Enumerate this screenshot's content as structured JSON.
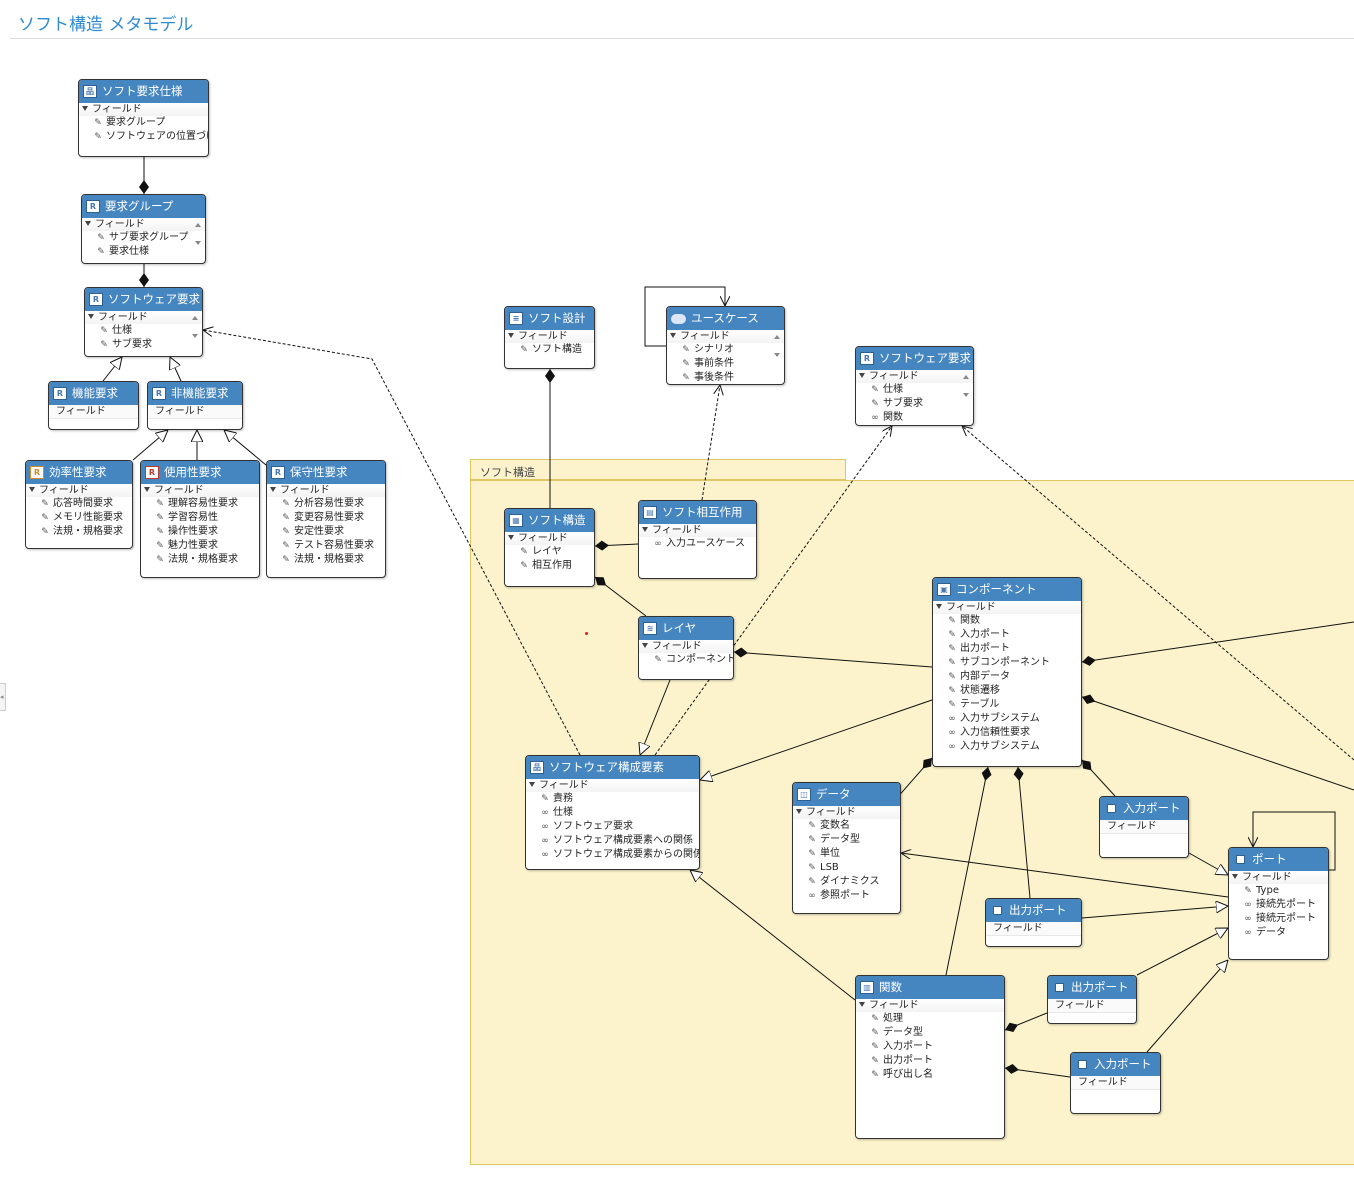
{
  "header": {
    "title": "ソフト構造 メタモデル"
  },
  "container": {
    "label": "ソフト構造"
  },
  "section_fields": "フィールド",
  "boxes": {
    "b_yokyushiyo": {
      "title": "ソフト要求仕様",
      "icon": "hierarchy-icon",
      "fields": [
        {
          "k": "wrench",
          "t": "要求グループ"
        },
        {
          "k": "wrench",
          "t": "ソフトウェアの位置づけ"
        }
      ]
    },
    "b_group": {
      "title": "要求グループ",
      "icon": "requirement-icon",
      "fields": [
        {
          "k": "wrench",
          "t": "サブ要求グループ"
        },
        {
          "k": "wrench",
          "t": "要求仕様"
        }
      ]
    },
    "b_swreq": {
      "title": "ソフトウェア要求",
      "icon": "requirement-icon",
      "fields": [
        {
          "k": "wrench",
          "t": "仕様"
        },
        {
          "k": "wrench",
          "t": "サブ要求"
        }
      ]
    },
    "b_kino": {
      "title": "機能要求",
      "icon": "requirement-icon",
      "fields": []
    },
    "b_hikino": {
      "title": "非機能要求",
      "icon": "requirement-icon",
      "fields": []
    },
    "b_koritsu": {
      "title": "効率性要求",
      "icon": "requirement-icon",
      "fields": [
        {
          "k": "wrench",
          "t": "応答時間要求"
        },
        {
          "k": "wrench",
          "t": "メモリ性能要求"
        },
        {
          "k": "wrench",
          "t": "法規・規格要求"
        }
      ]
    },
    "b_shiyosei": {
      "title": "使用性要求",
      "icon": "requirement-icon",
      "fields": [
        {
          "k": "wrench",
          "t": "理解容易性要求"
        },
        {
          "k": "wrench",
          "t": "学習容易性"
        },
        {
          "k": "wrench",
          "t": "操作性要求"
        },
        {
          "k": "wrench",
          "t": "魅力性要求"
        },
        {
          "k": "wrench",
          "t": "法規・規格要求"
        }
      ]
    },
    "b_hoshu": {
      "title": "保守性要求",
      "icon": "requirement-icon",
      "fields": [
        {
          "k": "wrench",
          "t": "分析容易性要求"
        },
        {
          "k": "wrench",
          "t": "変更容易性要求"
        },
        {
          "k": "wrench",
          "t": "安定性要求"
        },
        {
          "k": "wrench",
          "t": "テスト容易性要求"
        },
        {
          "k": "wrench",
          "t": "法規・規格要求"
        }
      ]
    },
    "b_sekkei": {
      "title": "ソフト設計",
      "icon": "table-icon",
      "fields": [
        {
          "k": "wrench",
          "t": "ソフト構造"
        }
      ]
    },
    "b_usecase": {
      "title": "ユースケース",
      "icon": "ellipse-icon",
      "fields": [
        {
          "k": "wrench",
          "t": "シナリオ"
        },
        {
          "k": "wrench",
          "t": "事前条件"
        },
        {
          "k": "wrench",
          "t": "事後条件"
        }
      ]
    },
    "b_swreq2": {
      "title": "ソフトウェア要求",
      "icon": "requirement-icon",
      "fields": [
        {
          "k": "wrench",
          "t": "仕様"
        },
        {
          "k": "wrench",
          "t": "サブ要求"
        },
        {
          "k": "link",
          "t": "関数"
        }
      ]
    },
    "b_kozo": {
      "title": "ソフト構造",
      "icon": "structure-icon",
      "fields": [
        {
          "k": "wrench",
          "t": "レイヤ"
        },
        {
          "k": "wrench",
          "t": "相互作用"
        }
      ]
    },
    "b_sogo": {
      "title": "ソフト相互作用",
      "icon": "interaction-icon",
      "fields": [
        {
          "k": "link",
          "t": "入力ユースケース"
        }
      ]
    },
    "b_layer": {
      "title": "レイヤ",
      "icon": "layers-icon",
      "fields": [
        {
          "k": "wrench",
          "t": "コンポーネント"
        }
      ]
    },
    "b_component": {
      "title": "コンポーネント",
      "icon": "component-icon",
      "fields": [
        {
          "k": "wrench",
          "t": "関数"
        },
        {
          "k": "wrench",
          "t": "入力ポート"
        },
        {
          "k": "wrench",
          "t": "出力ポート"
        },
        {
          "k": "wrench",
          "t": "サブコンポーネント"
        },
        {
          "k": "wrench",
          "t": "内部データ"
        },
        {
          "k": "wrench",
          "t": "状態遷移"
        },
        {
          "k": "wrench",
          "t": "テーブル"
        },
        {
          "k": "link",
          "t": "入力サブシステム"
        },
        {
          "k": "link",
          "t": "入力信頼性要求"
        },
        {
          "k": "link",
          "t": "入力サブシステム"
        }
      ]
    },
    "b_kosei": {
      "title": "ソフトウェア構成要素",
      "icon": "tree-icon",
      "fields": [
        {
          "k": "wrench",
          "t": "責務"
        },
        {
          "k": "link",
          "t": "仕様"
        },
        {
          "k": "link",
          "t": "ソフトウェア要求"
        },
        {
          "k": "link",
          "t": "ソフトウェア構成要素への関係"
        },
        {
          "k": "link",
          "t": "ソフトウェア構成要素からの関係"
        }
      ]
    },
    "b_data": {
      "title": "データ",
      "icon": "data-icon",
      "fields": [
        {
          "k": "wrench",
          "t": "変数名"
        },
        {
          "k": "wrench",
          "t": "データ型"
        },
        {
          "k": "wrench",
          "t": "単位"
        },
        {
          "k": "wrench",
          "t": "LSB"
        },
        {
          "k": "wrench",
          "t": "ダイナミクス"
        },
        {
          "k": "link",
          "t": "参照ポート"
        }
      ]
    },
    "b_inport1": {
      "title": "入力ポート",
      "icon": "port-icon",
      "fields": []
    },
    "b_port": {
      "title": "ポート",
      "icon": "port-icon",
      "fields": [
        {
          "k": "wrench",
          "t": "Type"
        },
        {
          "k": "link",
          "t": "接続先ポート"
        },
        {
          "k": "link",
          "t": "接続元ポート"
        },
        {
          "k": "link",
          "t": "データ"
        }
      ]
    },
    "b_outport1": {
      "title": "出力ポート",
      "icon": "port-icon",
      "fields": []
    },
    "b_kansu": {
      "title": "関数",
      "icon": "function-icon",
      "fields": [
        {
          "k": "wrench",
          "t": "処理"
        },
        {
          "k": "wrench",
          "t": "データ型"
        },
        {
          "k": "wrench",
          "t": "入力ポート"
        },
        {
          "k": "wrench",
          "t": "出力ポート"
        },
        {
          "k": "wrench",
          "t": "呼び出し名"
        }
      ]
    },
    "b_outport2": {
      "title": "出力ポート",
      "icon": "port-icon",
      "fields": []
    },
    "b_inport2": {
      "title": "入力ポート",
      "icon": "port-icon",
      "fields": []
    }
  },
  "connectors": [
    {
      "type": "composition",
      "from": "b_yokyushiyo",
      "to": "b_group"
    },
    {
      "type": "composition",
      "from": "b_group",
      "to": "b_swreq"
    },
    {
      "type": "generalization",
      "from": "b_kino",
      "to": "b_swreq"
    },
    {
      "type": "generalization",
      "from": "b_hikino",
      "to": "b_swreq"
    },
    {
      "type": "generalization",
      "from": "b_koritsu",
      "to": "b_hikino"
    },
    {
      "type": "generalization",
      "from": "b_shiyosei",
      "to": "b_hikino"
    },
    {
      "type": "generalization",
      "from": "b_hoshu",
      "to": "b_hikino"
    },
    {
      "type": "reference",
      "from": "b_kosei",
      "to": "b_swreq"
    },
    {
      "type": "composition",
      "from": "b_sekkei",
      "to": "b_kozo"
    },
    {
      "type": "reference",
      "from": "b_sogo",
      "to": "b_usecase"
    },
    {
      "type": "reference",
      "from": "b_usecase",
      "to": "b_usecase"
    },
    {
      "type": "reference",
      "from": "b_kosei",
      "to": "b_swreq2"
    },
    {
      "type": "reference",
      "from": "b_port",
      "to": "b_swreq2"
    },
    {
      "type": "composition",
      "from": "b_kozo",
      "to": "b_sogo"
    },
    {
      "type": "composition",
      "from": "b_kozo",
      "to": "b_layer"
    },
    {
      "type": "composition",
      "from": "b_layer",
      "to": "b_component"
    },
    {
      "type": "generalization",
      "from": "b_layer",
      "to": "b_kosei"
    },
    {
      "type": "generalization",
      "from": "b_component",
      "to": "b_kosei"
    },
    {
      "type": "generalization",
      "from": "b_kansu",
      "to": "b_kosei"
    },
    {
      "type": "composition",
      "from": "b_component",
      "to": "b_data"
    },
    {
      "type": "composition",
      "from": "b_component",
      "to": "b_kansu"
    },
    {
      "type": "composition",
      "from": "b_component",
      "to": "b_outport1"
    },
    {
      "type": "composition",
      "from": "b_component",
      "to": "b_inport1"
    },
    {
      "type": "composition",
      "from": "b_component",
      "to": "b_port"
    },
    {
      "type": "association",
      "from": "b_port",
      "to": "b_data"
    },
    {
      "type": "generalization",
      "from": "b_inport1",
      "to": "b_port"
    },
    {
      "type": "generalization",
      "from": "b_outport1",
      "to": "b_port"
    },
    {
      "type": "generalization",
      "from": "b_outport2",
      "to": "b_port"
    },
    {
      "type": "generalization",
      "from": "b_inport2",
      "to": "b_port"
    },
    {
      "type": "composition",
      "from": "b_kansu",
      "to": "b_outport2"
    },
    {
      "type": "composition",
      "from": "b_kansu",
      "to": "b_inport2"
    },
    {
      "type": "reference",
      "from": "b_port",
      "to": "b_port"
    }
  ]
}
